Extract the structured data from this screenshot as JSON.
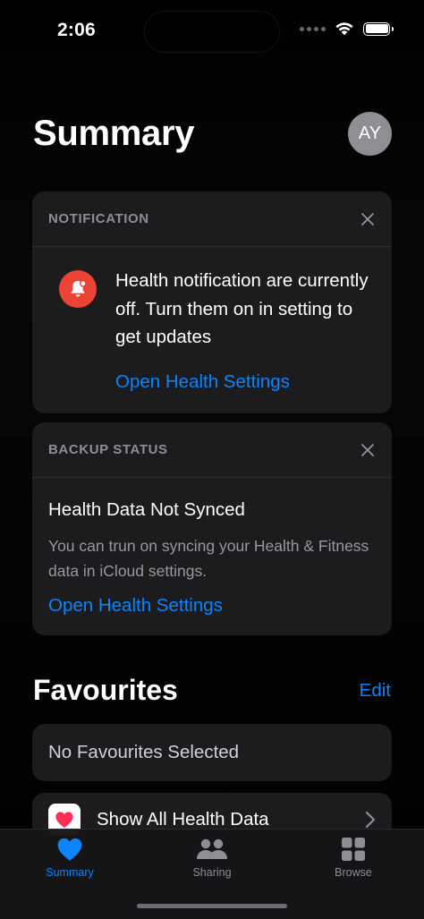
{
  "status_bar": {
    "time": "2:06"
  },
  "header": {
    "title": "Summary",
    "avatar_initials": "AY"
  },
  "notification_card": {
    "header": "NOTIFICATION",
    "message": "Health notification are currently off. Turn them on in setting to get updates",
    "link": "Open Health Settings",
    "badge_color": "#eb4335"
  },
  "backup_card": {
    "header": "BACKUP STATUS",
    "title": "Health Data Not Synced",
    "description": "You can trun on syncing your Health & Fitness data in iCloud settings.",
    "link": "Open Health Settings"
  },
  "favourites": {
    "title": "Favourites",
    "edit_label": "Edit",
    "empty_text": "No Favourites Selected",
    "show_all_label": "Show All Health Data"
  },
  "tab_bar": {
    "active_color": "#0a84ff",
    "inactive_color": "#8e8e93",
    "tabs": [
      {
        "label": "Summary",
        "icon": "heart-icon",
        "active": true
      },
      {
        "label": "Sharing",
        "icon": "people-icon",
        "active": false
      },
      {
        "label": "Browse",
        "icon": "grid-icon",
        "active": false
      }
    ]
  },
  "colors": {
    "accent": "#0a84ff",
    "card_bg": "#1c1c1e",
    "background": "#000000"
  }
}
